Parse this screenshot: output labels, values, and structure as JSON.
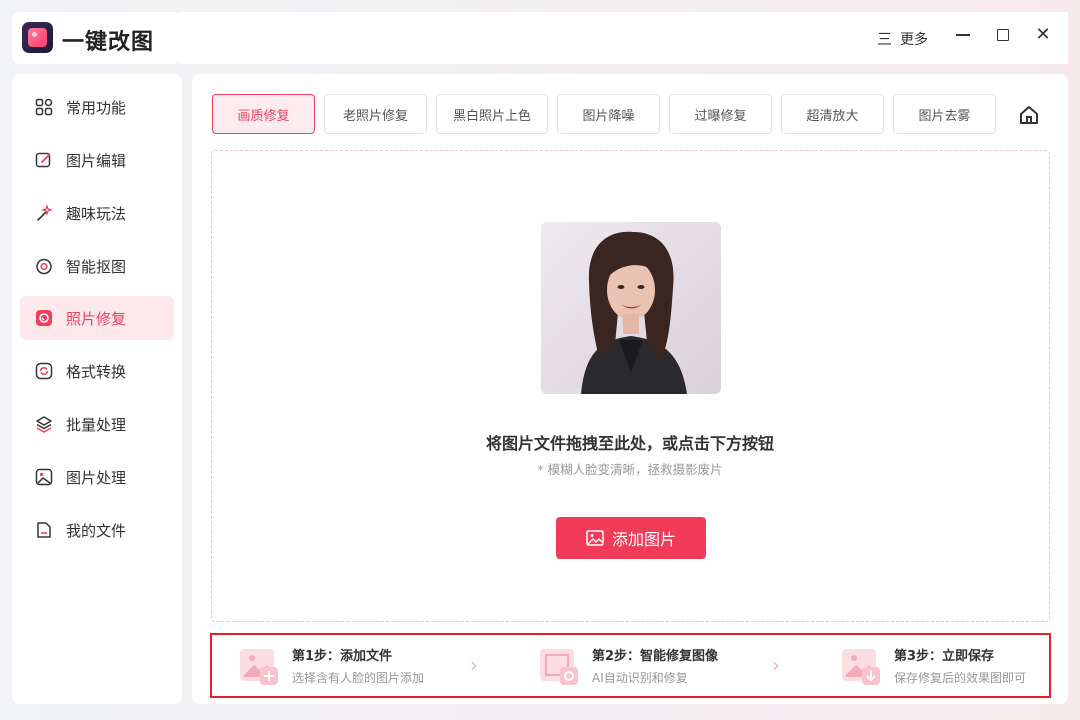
{
  "app": {
    "title": "一键改图"
  },
  "window": {
    "more_label": "更多",
    "more_glyph": "三"
  },
  "sidebar": {
    "items": [
      {
        "label": "常用功能",
        "icon": "grid-icon"
      },
      {
        "label": "图片编辑",
        "icon": "edit-icon"
      },
      {
        "label": "趣味玩法",
        "icon": "magic-wand-icon"
      },
      {
        "label": "智能抠图",
        "icon": "target-icon"
      },
      {
        "label": "照片修复",
        "icon": "photo-repair-icon",
        "active": true
      },
      {
        "label": "格式转换",
        "icon": "convert-icon"
      },
      {
        "label": "批量处理",
        "icon": "layers-icon"
      },
      {
        "label": "图片处理",
        "icon": "image-icon"
      },
      {
        "label": "我的文件",
        "icon": "file-icon"
      }
    ]
  },
  "tabs": [
    {
      "label": "画质修复",
      "active": true
    },
    {
      "label": "老照片修复"
    },
    {
      "label": "黑白照片上色"
    },
    {
      "label": "图片降噪"
    },
    {
      "label": "过曝修复"
    },
    {
      "label": "超清放大"
    },
    {
      "label": "图片去雾"
    }
  ],
  "dropzone": {
    "title": "将图片文件拖拽至此处，或点击下方按钮",
    "subtitle": "* 模糊人脸变清晰，拯救摄影废片",
    "button_label": "添加图片"
  },
  "steps": [
    {
      "title": "第1步：添加文件",
      "desc": "选择含有人脸的图片添加"
    },
    {
      "title": "第2步：智能修复图像",
      "desc": "AI自动识别和修复"
    },
    {
      "title": "第3步：立即保存",
      "desc": "保存修复后的效果图即可"
    }
  ],
  "colors": {
    "accent": "#f23b58",
    "active_bg": "#fde8ec",
    "highlight_border": "#e4202a"
  }
}
